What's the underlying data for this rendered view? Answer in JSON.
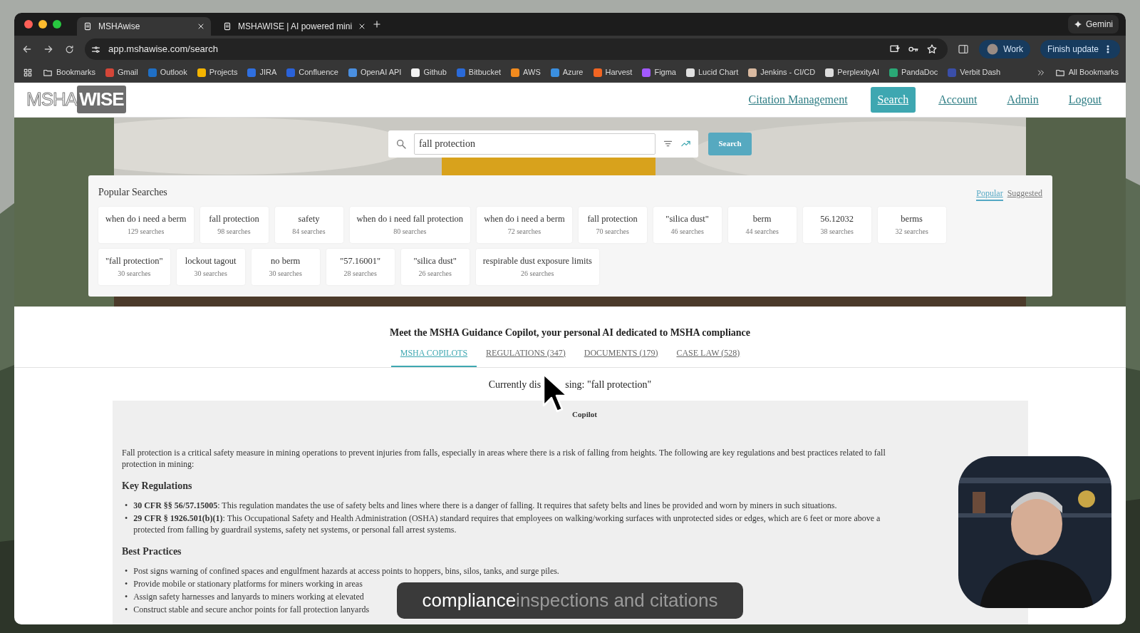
{
  "browser": {
    "tabs": [
      {
        "title": "MSHAwise",
        "selected": true
      },
      {
        "title": "MSHAWISE | AI powered mini",
        "selected": false
      }
    ],
    "gemini": "Gemini",
    "url": "app.mshawise.com/search",
    "profile": "Work",
    "update": "Finish update",
    "bookmarks": [
      {
        "label": "Bookmarks",
        "kind": "folder"
      },
      {
        "label": "Gmail",
        "kind": "site",
        "color": "#d44638"
      },
      {
        "label": "Outlook",
        "kind": "site",
        "color": "#1f6fc5"
      },
      {
        "label": "Projects",
        "kind": "site",
        "color": "#f4b400"
      },
      {
        "label": "JIRA",
        "kind": "site",
        "color": "#2f6fe0"
      },
      {
        "label": "Confluence",
        "kind": "site",
        "color": "#2a62d9"
      },
      {
        "label": "OpenAI API",
        "kind": "site",
        "color": "#4a8fe0"
      },
      {
        "label": "Github",
        "kind": "site",
        "color": "#f2f2f2"
      },
      {
        "label": "Bitbucket",
        "kind": "site",
        "color": "#2a6ad9"
      },
      {
        "label": "AWS",
        "kind": "site",
        "color": "#f28b1e"
      },
      {
        "label": "Azure",
        "kind": "site",
        "color": "#3a8fe0"
      },
      {
        "label": "Harvest",
        "kind": "site",
        "color": "#f26522"
      },
      {
        "label": "Figma",
        "kind": "site",
        "color": "#a259ff"
      },
      {
        "label": "Lucid Chart",
        "kind": "site",
        "color": "#e0e0e0"
      },
      {
        "label": "Jenkins - CI/CD",
        "kind": "site",
        "color": "#d9b9a0"
      },
      {
        "label": "PerplexityAI",
        "kind": "site",
        "color": "#dddddd"
      },
      {
        "label": "PandaDoc",
        "kind": "site",
        "color": "#2aa876"
      },
      {
        "label": "Verbit Dash",
        "kind": "site",
        "color": "#3a4ea8"
      }
    ],
    "all_bookmarks": "All Bookmarks"
  },
  "nav": {
    "logo": {
      "left": "MSHA",
      "right": "WISE"
    },
    "links": [
      {
        "label": "Citation Management",
        "selected": false
      },
      {
        "label": "Search",
        "selected": true
      },
      {
        "label": "Account",
        "selected": false
      },
      {
        "label": "Admin",
        "selected": false
      },
      {
        "label": "Logout",
        "selected": false
      }
    ]
  },
  "search": {
    "value": "fall protection",
    "button": "Search"
  },
  "popular": {
    "title": "Popular Searches",
    "toggle": [
      {
        "label": "Popular",
        "selected": true
      },
      {
        "label": "Suggested",
        "selected": false
      }
    ],
    "items": [
      {
        "query": "when do i need a berm",
        "count": "129 searches"
      },
      {
        "query": "fall protection",
        "count": "98 searches"
      },
      {
        "query": "safety",
        "count": "84 searches"
      },
      {
        "query": "when do i need fall protection",
        "count": "80 searches"
      },
      {
        "query": "when do i need a berm",
        "count": "72 searches"
      },
      {
        "query": "fall protection",
        "count": "70 searches"
      },
      {
        "query": "\"silica dust\"",
        "count": "46 searches"
      },
      {
        "query": "berm",
        "count": "44 searches"
      },
      {
        "query": "56.12032",
        "count": "38 searches"
      },
      {
        "query": "berms",
        "count": "32 searches"
      },
      {
        "query": "\"fall protection\"",
        "count": "30 searches"
      },
      {
        "query": "lockout tagout",
        "count": "30 searches"
      },
      {
        "query": "no berm",
        "count": "30 searches"
      },
      {
        "query": "\"57.16001\"",
        "count": "28 searches"
      },
      {
        "query": "\"silica dust\"",
        "count": "26 searches"
      },
      {
        "query": "respirable dust exposure limits",
        "count": "26 searches"
      }
    ]
  },
  "intro": "Meet the MSHA Guidance Copilot, your personal AI dedicated to MSHA compliance",
  "result_tabs": [
    {
      "label": "MSHA COPILOTS",
      "selected": true
    },
    {
      "label": "REGULATIONS (347)",
      "selected": false
    },
    {
      "label": "DOCUMENTS (179)",
      "selected": false
    },
    {
      "label": "CASE LAW (528)",
      "selected": false
    }
  ],
  "discussing": {
    "before": "Currently dis",
    "after": "sing: \"fall protection\""
  },
  "answer": {
    "label": "Copilot",
    "intro_lines": [
      "Fall protection is a critical safety measure in mining operations to prevent injuries from falls, especially in areas where there is a risk of falling from heights. The following are key regulations and best practices related to fall",
      "protection in mining:"
    ],
    "sections": [
      {
        "heading": "Key Regulations",
        "marker": "•",
        "bullets": [
          [
            "**30 CFR §§ 56/57.15005**: This regulation mandates the use of safety belts and lines where there is a danger of falling. It requires that safety belts and lines be provided and worn by miners in such situations."
          ],
          [
            "**29 CFR § 1926.501(b)(1)**: This Occupational Safety and Health Administration (OSHA) standard requires that employees on walking/working surfaces with unprotected sides or edges, which are 6 feet or more above a",
            "protected from falling by guardrail systems, safety net systems, or personal fall arrest systems."
          ]
        ]
      },
      {
        "heading": "Best Practices",
        "marker": "•",
        "bullets": [
          [
            "Post signs warning of confined spaces and engulfment hazards at access points to hoppers, bins, silos, tanks, and surge piles."
          ],
          [
            "Provide mobile or stationary platforms for miners working in areas"
          ],
          [
            "Assign safety harnesses and lanyards to miners working at elevated"
          ],
          [
            "Construct stable and secure anchor points for fall protection lanyards"
          ]
        ]
      }
    ]
  },
  "caption": {
    "spoken": "compliance",
    "upcoming": "inspections and citations"
  }
}
